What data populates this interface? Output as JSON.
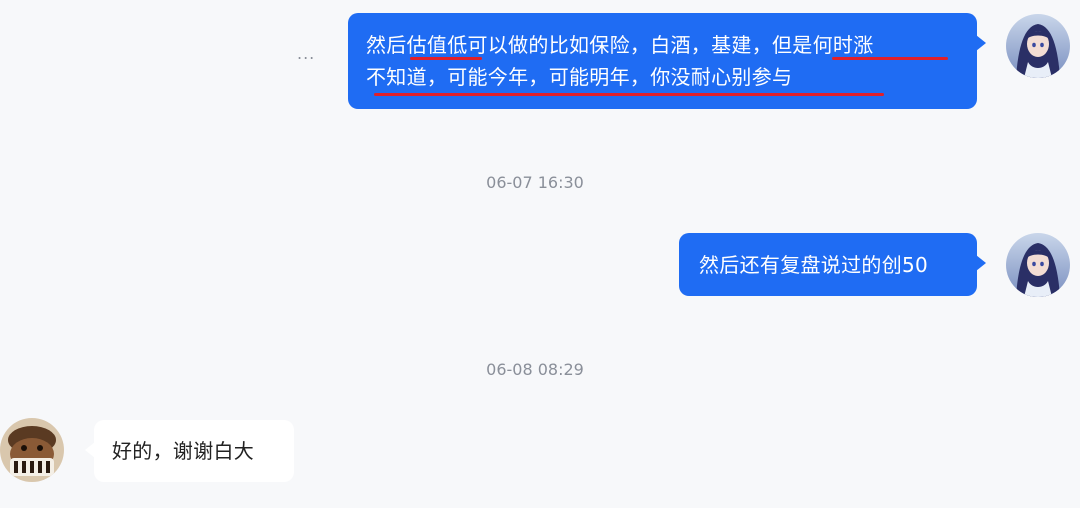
{
  "conversation": {
    "more_indicator": "...",
    "message1": {
      "line1": "然后估值低可以做的比如保险，白酒，基建，但是何时涨",
      "line2": "不知道，可能今年，可能明年，你没耐心别参与"
    },
    "timestamp1": "06-07 16:30",
    "message2": "然后还有复盘说过的创50",
    "timestamp2": "06-08 08:29",
    "message3": "好的，谢谢白大"
  },
  "colors": {
    "outgoing_bubble": "#1f6cf3",
    "incoming_bubble": "#ffffff",
    "underline": "#e0202a",
    "background": "#f7f8fa"
  },
  "icons": {
    "self_avatar": "anime-girl-avatar",
    "other_avatar": "brown-character-avatar",
    "more": "ellipsis-icon"
  }
}
